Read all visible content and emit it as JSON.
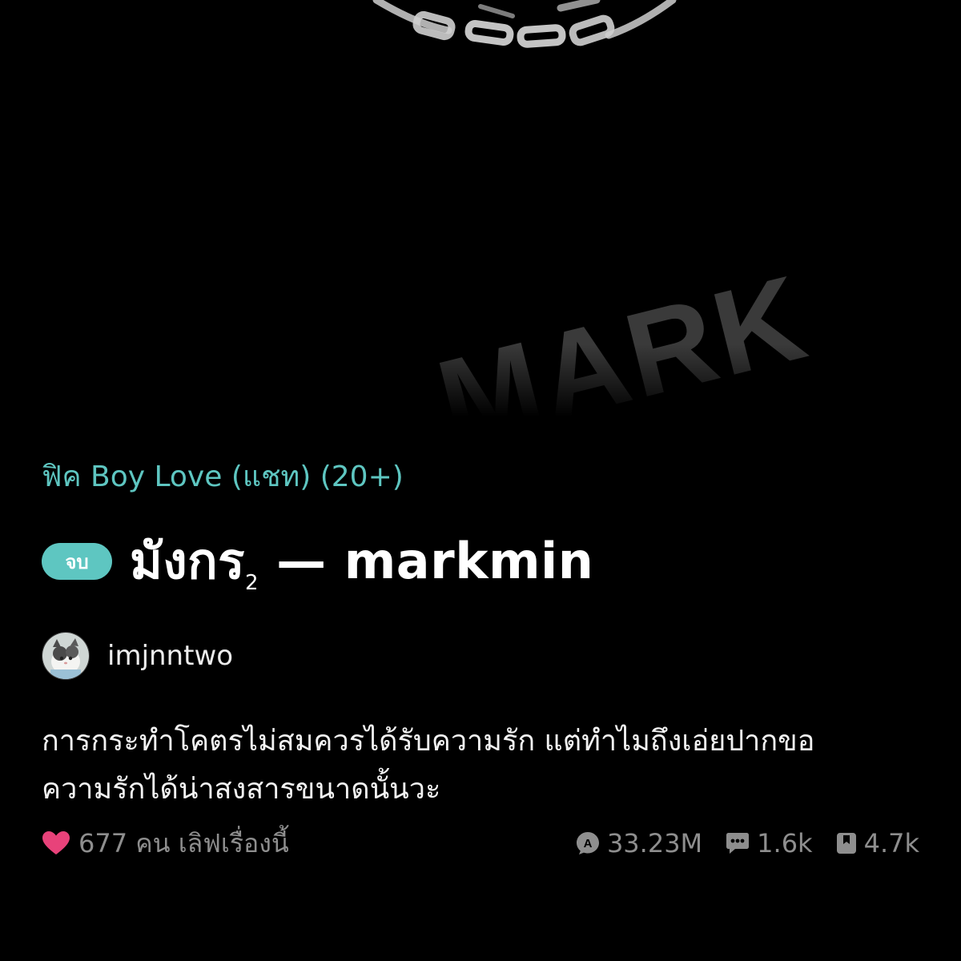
{
  "cover": {
    "watermark_text": "MARK"
  },
  "story": {
    "category": "ฟิค Boy Love (แชท) (20+)",
    "status_badge": "จบ",
    "title_main": "มังกร",
    "title_subscript": "2",
    "title_rest": " — markmin",
    "author": {
      "name": "imjnntwo",
      "avatar_icon": "cat-avatar-icon"
    },
    "description_lines": [
      "การกระทำโคตรไม่สมควรได้รับความรัก แต่ทำไมถึงเอ่ยปากขอ",
      "ความรักได้น่าสงสารขนาดนั้นวะ"
    ],
    "likes": {
      "icon": "heart-icon",
      "text": "677 คน เลิฟเรื่องนี้",
      "color": "#e8427a"
    },
    "stats": {
      "views": {
        "icon": "views-icon",
        "value": "33.23M"
      },
      "comments": {
        "icon": "comment-icon",
        "value": "1.6k"
      },
      "bookmarks": {
        "icon": "bookmark-icon",
        "value": "4.7k"
      }
    }
  },
  "colors": {
    "accent": "#5ec6c1",
    "background": "#000000",
    "muted_text": "#8e8e8e"
  }
}
